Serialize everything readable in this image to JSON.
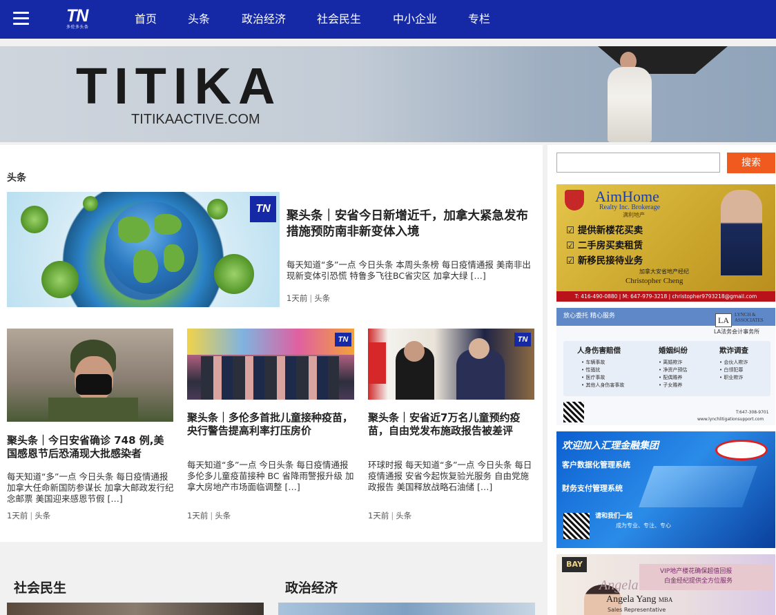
{
  "nav": {
    "logo_mark": "TN",
    "logo_sub": "多伦多头条",
    "items": [
      "首页",
      "头条",
      "政治经济",
      "社会民生",
      "中小企业",
      "专栏"
    ]
  },
  "banner": {
    "title": "TITIKA",
    "url": "TITIKAACTIVE.COM"
  },
  "main": {
    "section_label": "头条",
    "hero": {
      "badge": "TN",
      "title": "聚头条｜安省今日新增近千，加拿大紧急发布措施预防南非新变体入境",
      "excerpt": "每天知道“多”一点 今日头条 本周头条榜 每日疫情通报 美南非出现新变体引恐慌 特鲁多飞往BC省灾区 加拿大绿 […]",
      "time": "1天前",
      "category": "头条"
    },
    "cards": [
      {
        "title": "聚头条｜今日安省确诊 748 例,美国感恩节后恐涌现大批感染者",
        "excerpt": "每天知道“多”一点 今日头条 每日疫情通报 加拿大任命新国防参谋长  加拿大邮政发行纪念邮票 美国迎来感恩节假 […]",
        "time": "1天前",
        "category": "头条"
      },
      {
        "title": "聚头条｜多伦多首批儿童接种疫苗，央行警告提高利率打压房价",
        "excerpt": "每天知道“多”一点 今日头条 每日疫情通报 多伦多儿童疫苗接种 BC 省降雨警报升级 加拿大房地产市场面临调整 […]",
        "time": "1天前",
        "category": "头条"
      },
      {
        "title": "聚头条｜安省近7万名儿童预约疫苗，自由党发布施政报告被差评",
        "excerpt": "环球时报 每天知道“多”一点 今日头条 每日疫情通报 安省今起恢复验光服务 自由党施政报告 美国释放战略石油储 […]",
        "time": "1天前",
        "category": "头条"
      }
    ]
  },
  "sidebar": {
    "search_placeholder": "",
    "search_button": "搜索",
    "ad1": {
      "brand": "AimHome",
      "sub": "Realty Inc. Brokerage",
      "sub_cn": "满利地产",
      "lines": [
        "提供新楼花买卖",
        "二手房买卖租赁",
        "新移民接待业务"
      ],
      "agent_title": "加拿大安省地产经纪",
      "agent_name": "Christopher Cheng",
      "contact": "T: 416-490-0880 | M: 647-979-3218 | christopher9793218@gmail.com"
    },
    "ad2": {
      "tag": "放心委托  精心服务",
      "firm": "LYNCH & ASSOCIATES",
      "firm_cn": "LA法务会计事务所",
      "col1_title": "人身伤害赔偿",
      "col1": [
        "车辆事故",
        "性骚扰",
        "医疗事故",
        "其他人身伤害事故"
      ],
      "col2_title": "婚姻纠纷",
      "col2": [
        "离婚欺诈",
        "净资产预估",
        "配偶赡养",
        "子女赡养"
      ],
      "col3_title": "欺诈调查",
      "col3": [
        "会伙人欺诈",
        "白领犯罪",
        "职业欺诈"
      ],
      "phone": "T:647-308-9701",
      "site": "www.lynchlitigationsupport.com"
    },
    "ad3": {
      "title": "欢迎加入汇理金融集团",
      "line1": "客户数据化管理系统",
      "line2": "财务支付管理系统",
      "line3": "请和我们一起",
      "line4": "成为专业、专注、专心"
    },
    "ad4": {
      "logo": "BAY",
      "banner": "VIP地产楼花确保超值回报",
      "banner2": "白金经纪提供全方位服务",
      "script_name": "Angela",
      "name": "Angela Yang",
      "suffix": "MBA",
      "role": "Sales Representative"
    }
  },
  "sections": {
    "left": "社会民生",
    "right": "政治经济"
  },
  "colors": {
    "nav_bg": "#1529a6",
    "search_button": "#f05a1f"
  }
}
